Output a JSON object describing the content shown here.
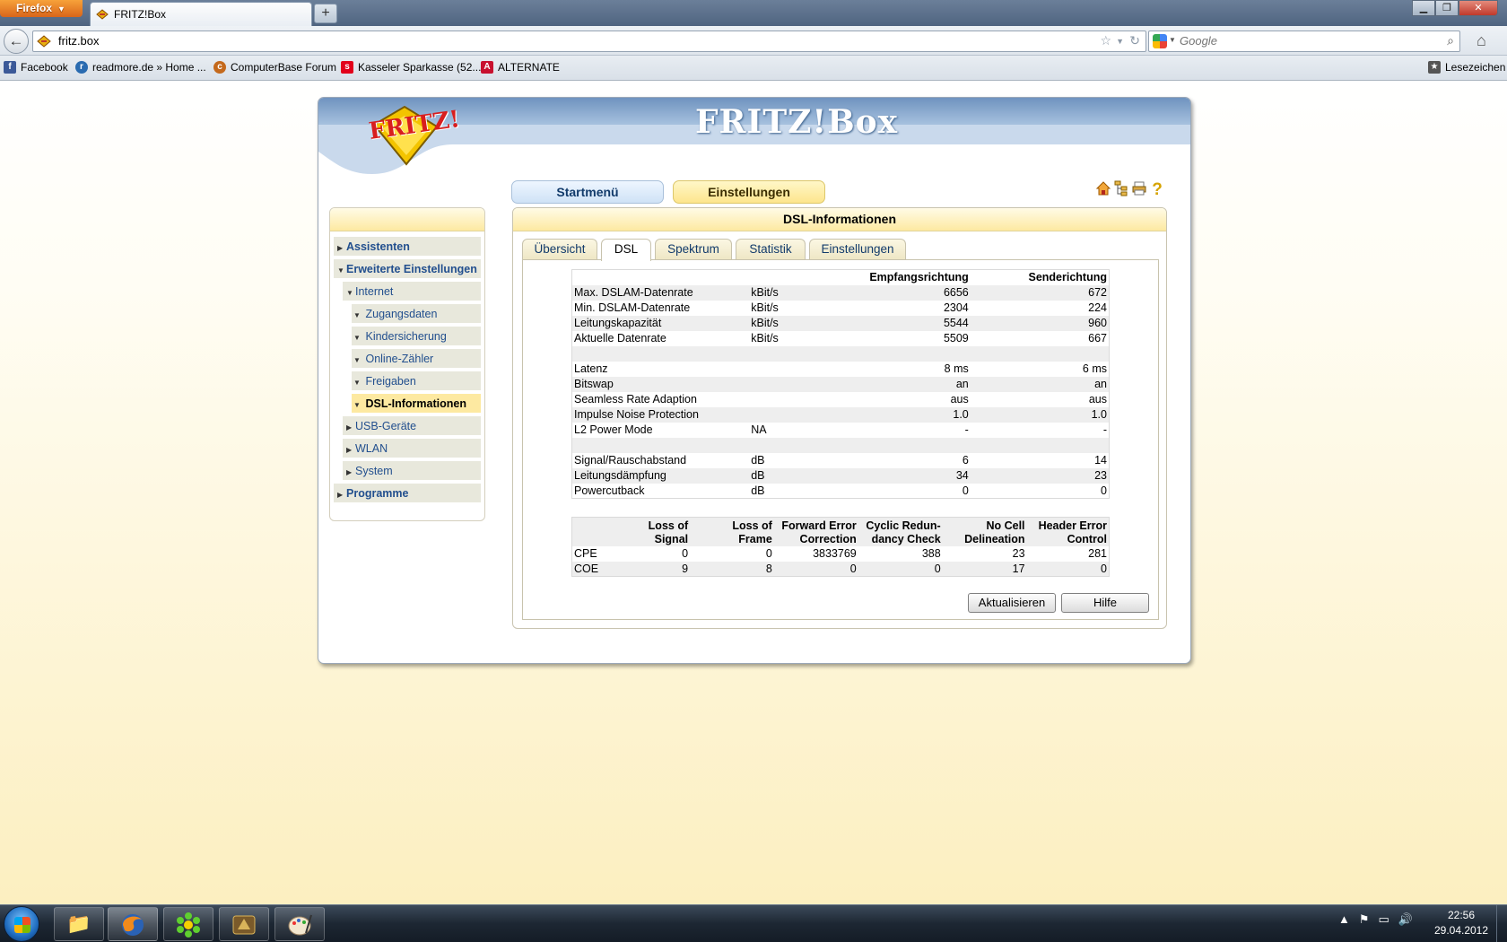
{
  "browser": {
    "app_button": "Firefox",
    "tab_title": "FRITZ!Box",
    "url": "fritz.box",
    "search_placeholder": "Google",
    "bookmarks": [
      "Facebook",
      "readmore.de » Home ...",
      "ComputerBase Forum",
      "Kasseler Sparkasse (52...",
      "ALTERNATE"
    ],
    "bookmarks_menu": "Lesezeichen"
  },
  "fritz": {
    "title": "FRITZ!Box",
    "logo_text": "FRITZ!",
    "top_buttons": {
      "start": "Startmenü",
      "settings": "Einstellungen"
    },
    "sidebar": [
      {
        "label": "Assistenten",
        "level": 0
      },
      {
        "label": "Erweiterte Einstellungen",
        "level": 0
      },
      {
        "label": "Internet",
        "level": 1
      },
      {
        "label": "Zugangsdaten",
        "level": 2
      },
      {
        "label": "Kindersicherung",
        "level": 2
      },
      {
        "label": "Online-Zähler",
        "level": 2
      },
      {
        "label": "Freigaben",
        "level": 2
      },
      {
        "label": "DSL-Informationen",
        "level": 2
      },
      {
        "label": "USB-Geräte",
        "level": 1
      },
      {
        "label": "WLAN",
        "level": 1
      },
      {
        "label": "System",
        "level": 1
      },
      {
        "label": "Programme",
        "level": 0
      }
    ],
    "panel_title": "DSL-Informationen",
    "tabs": [
      "Übersicht",
      "DSL",
      "Spektrum",
      "Statistik",
      "Einstellungen"
    ],
    "active_tab": "DSL",
    "table1": {
      "headers": [
        "",
        "",
        "Empfangsrichtung",
        "Senderichtung"
      ],
      "rows": [
        [
          "Max. DSLAM-Datenrate",
          "kBit/s",
          "6656",
          "672"
        ],
        [
          "Min. DSLAM-Datenrate",
          "kBit/s",
          "2304",
          "224"
        ],
        [
          "Leitungskapazität",
          "kBit/s",
          "5544",
          "960"
        ],
        [
          "Aktuelle Datenrate",
          "kBit/s",
          "5509",
          "667"
        ],
        [
          "",
          "",
          "",
          ""
        ],
        [
          "Latenz",
          "",
          "8 ms",
          "6 ms"
        ],
        [
          "Bitswap",
          "",
          "an",
          "an"
        ],
        [
          "Seamless Rate Adaption",
          "",
          "aus",
          "aus"
        ],
        [
          "Impulse Noise Protection",
          "",
          "1.0",
          "1.0"
        ],
        [
          "L2 Power Mode",
          "NA",
          "-",
          "-"
        ],
        [
          "",
          "",
          "",
          ""
        ],
        [
          "Signal/Rauschabstand",
          "dB",
          "6",
          "14"
        ],
        [
          "Leitungsdämpfung",
          "dB",
          "34",
          "23"
        ],
        [
          "Powercutback",
          "dB",
          "0",
          "0"
        ]
      ]
    },
    "table2": {
      "headers": [
        [
          "",
          ""
        ],
        [
          "Loss of",
          "Signal"
        ],
        [
          "Loss of",
          "Frame"
        ],
        [
          "Forward Error",
          "Correction"
        ],
        [
          "Cyclic Redun-",
          "dancy Check"
        ],
        [
          "No Cell",
          "Delineation"
        ],
        [
          "Header Error",
          "Control"
        ]
      ],
      "rows": [
        [
          "CPE",
          "0",
          "0",
          "3833769",
          "388",
          "23",
          "281"
        ],
        [
          "COE",
          "9",
          "8",
          "0",
          "0",
          "17",
          "0"
        ]
      ]
    },
    "buttons": {
      "refresh": "Aktualisieren",
      "help": "Hilfe"
    }
  },
  "taskbar": {
    "time": "22:56",
    "date": "29.04.2012"
  }
}
